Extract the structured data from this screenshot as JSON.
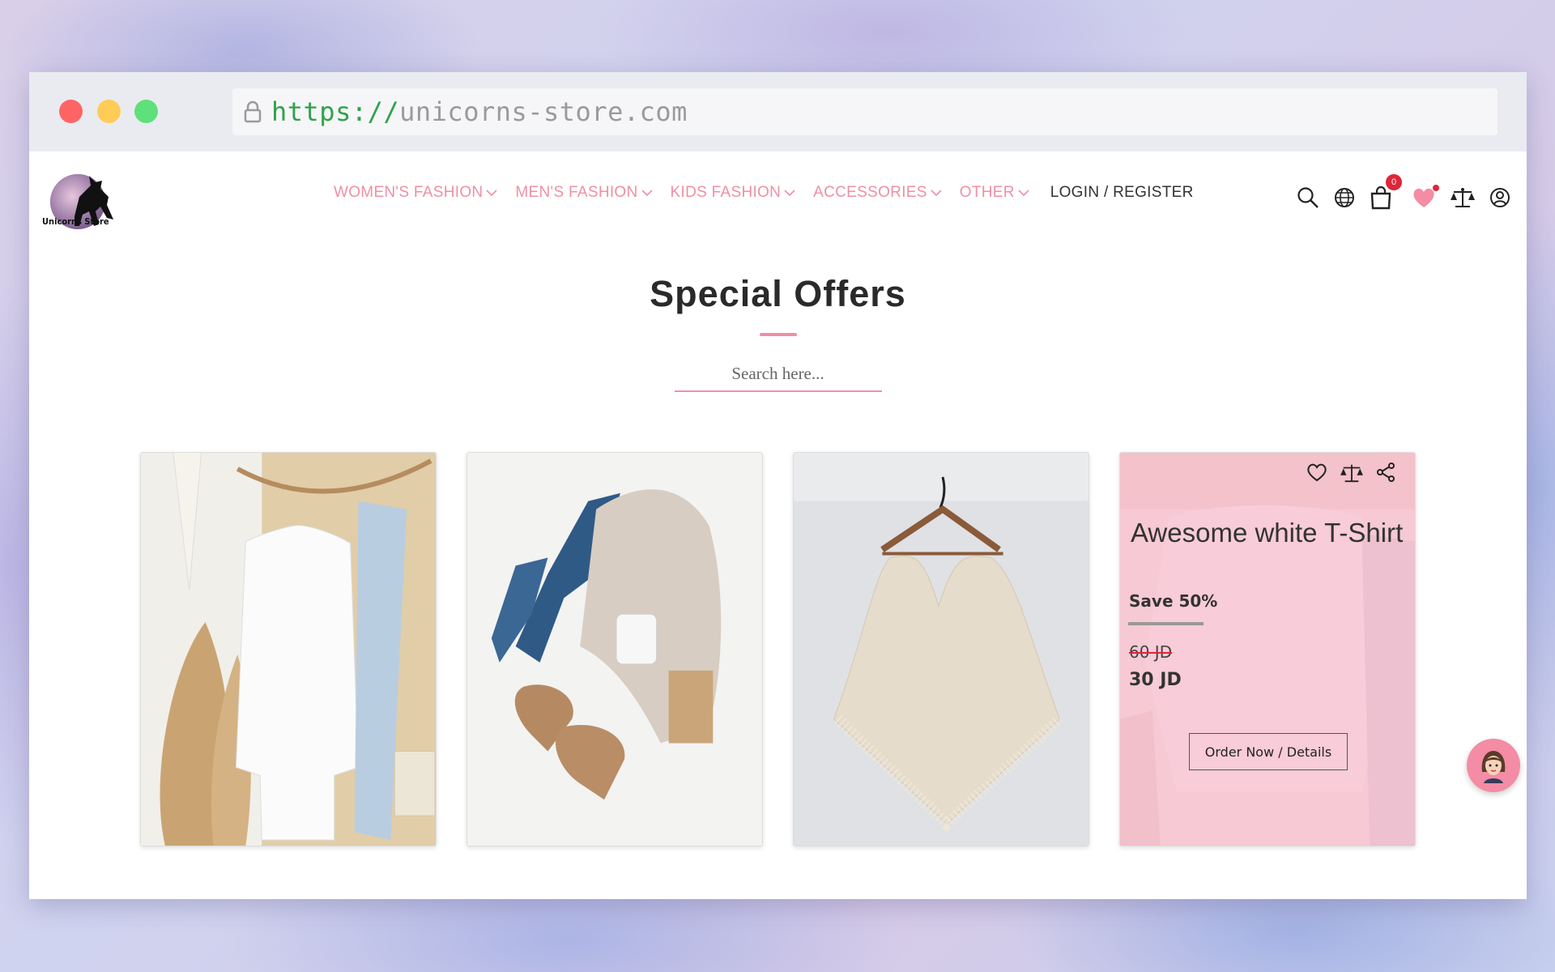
{
  "browser": {
    "url_scheme": "https://",
    "url_host": "unicorns-store.com"
  },
  "logo": {
    "text": "Unicorns Store"
  },
  "nav": {
    "items": [
      {
        "label": "WOMEN'S FASHION"
      },
      {
        "label": "MEN'S FASHION"
      },
      {
        "label": "KIDS FASHION"
      },
      {
        "label": "ACCESSORIES"
      },
      {
        "label": "OTHER"
      }
    ],
    "login_label": "LOGIN / REGISTER"
  },
  "header_icons": {
    "cart_count": "0",
    "accent": "#ef8fa6"
  },
  "main": {
    "title": "Special Offers",
    "search_placeholder": "Search here..."
  },
  "products": [
    {
      "image": "white-hoodie-hanging"
    },
    {
      "image": "jeans-sweater-boots-flatlay"
    },
    {
      "image": "knit-poncho-on-hanger"
    },
    {
      "image": "white-sweater",
      "title": "Awesome white T-Shirt",
      "save": "Save 50%",
      "old_price": "60 JD",
      "new_price": "30 JD",
      "button": "Order Now / Details"
    }
  ]
}
